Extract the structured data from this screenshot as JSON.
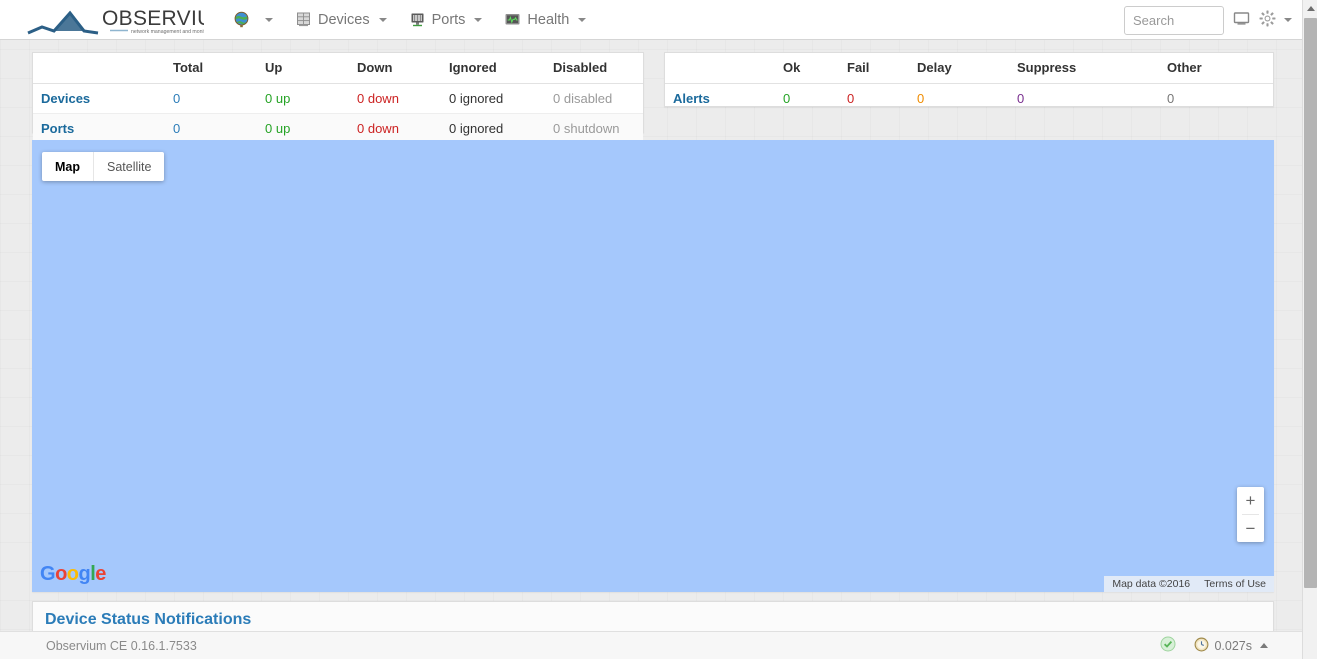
{
  "navbar": {
    "brand": {
      "name": "OBSERVIUM",
      "tagline": "network management and monitoring",
      "icon": "observium-logo"
    },
    "items": [
      {
        "id": "globe",
        "label": "",
        "icon": "globe-icon",
        "has_caret": true
      },
      {
        "id": "devices",
        "label": "Devices",
        "icon": "server-rack-icon",
        "has_caret": true
      },
      {
        "id": "ports",
        "label": "Ports",
        "icon": "network-port-icon",
        "has_caret": true
      },
      {
        "id": "health",
        "label": "Health",
        "icon": "health-monitor-icon",
        "has_caret": true
      }
    ],
    "search": {
      "value": "",
      "placeholder": "Search"
    },
    "display_icon": "monitor-icon",
    "settings_icon": "gear-icon"
  },
  "stats_table": {
    "headers": [
      "",
      "Total",
      "Up",
      "Down",
      "Ignored",
      "Disabled"
    ],
    "rows": [
      {
        "label": "Devices",
        "total": "0",
        "up": "0 up",
        "down": "0 down",
        "ignored": "0 ignored",
        "disabled": "0 disabled"
      },
      {
        "label": "Ports",
        "total": "0",
        "up": "0 up",
        "down": "0 down",
        "ignored": "0 ignored",
        "disabled": "0 shutdown"
      }
    ]
  },
  "alerts_table": {
    "headers": [
      "",
      "Ok",
      "Fail",
      "Delay",
      "Suppress",
      "Other"
    ],
    "rows": [
      {
        "label": "Alerts",
        "ok": "0",
        "fail": "0",
        "delay": "0",
        "suppress": "0",
        "other": "0"
      }
    ]
  },
  "map": {
    "type_buttons": [
      {
        "label": "Map",
        "active": true
      },
      {
        "label": "Satellite",
        "active": false
      }
    ],
    "zoom_in": "+",
    "zoom_out": "−",
    "provider_logo": "Google",
    "attribution": "Map data ©2016",
    "terms": "Terms of Use",
    "background_color": "#a5c8fc"
  },
  "notifications_panel": {
    "title": "Device Status Notifications"
  },
  "footer": {
    "version": "Observium CE 0.16.1.7533",
    "status_icon": "check-circle-icon",
    "time_icon": "clock-icon",
    "generation_time": "0.027s"
  },
  "colors": {
    "link": "#2b7cb8",
    "up": "#25a325",
    "down": "#cc2222",
    "delay": "#f08c00",
    "suppress": "#7a2f8f",
    "muted": "#9a9a9a"
  }
}
